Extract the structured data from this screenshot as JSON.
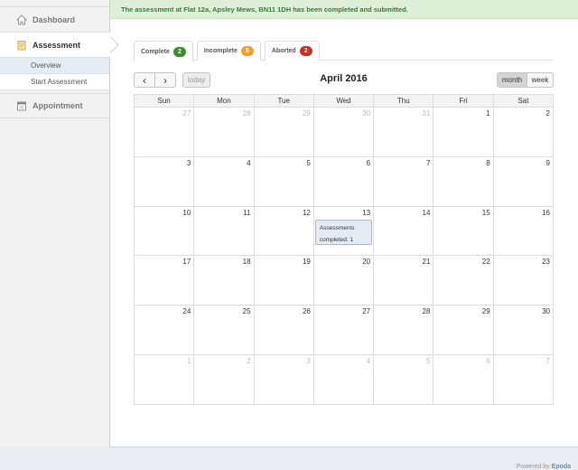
{
  "alert": {
    "text": "The assessment at Flat 12a, Apsley Mews, BN11 1DH has been completed and submitted."
  },
  "sidebar": {
    "dashboard": "Dashboard",
    "assessment": "Assessment",
    "sub": [
      "Overview",
      "Start Assessment"
    ],
    "appointment": "Appointment"
  },
  "tabs": [
    {
      "label": "Complete",
      "count": "2",
      "color": "#3c8d2f"
    },
    {
      "label": "Incomplete",
      "count": "0",
      "color": "#f0a02a"
    },
    {
      "label": "Aborted",
      "count": "2",
      "color": "#c9302c"
    }
  ],
  "toolbar": {
    "prev": "‹",
    "next": "›",
    "today": "today",
    "title": "April 2016",
    "month": "month",
    "week": "week"
  },
  "calendar": {
    "days_of_week": [
      "Sun",
      "Mon",
      "Tue",
      "Wed",
      "Thu",
      "Fri",
      "Sat"
    ],
    "weeks": [
      [
        [
          "27",
          true
        ],
        [
          "28",
          true
        ],
        [
          "29",
          true
        ],
        [
          "30",
          true
        ],
        [
          "31",
          true
        ],
        [
          "1",
          false
        ],
        [
          "2",
          false
        ]
      ],
      [
        [
          "3",
          false
        ],
        [
          "4",
          false
        ],
        [
          "5",
          false
        ],
        [
          "6",
          false
        ],
        [
          "7",
          false
        ],
        [
          "8",
          false
        ],
        [
          "9",
          false
        ]
      ],
      [
        [
          "10",
          false
        ],
        [
          "11",
          false
        ],
        [
          "12",
          false
        ],
        [
          "13",
          false
        ],
        [
          "14",
          false
        ],
        [
          "15",
          false
        ],
        [
          "16",
          false
        ]
      ],
      [
        [
          "17",
          false
        ],
        [
          "18",
          false
        ],
        [
          "19",
          false
        ],
        [
          "20",
          false
        ],
        [
          "21",
          false
        ],
        [
          "22",
          false
        ],
        [
          "23",
          false
        ]
      ],
      [
        [
          "24",
          false
        ],
        [
          "25",
          false
        ],
        [
          "26",
          false
        ],
        [
          "27",
          false
        ],
        [
          "28",
          false
        ],
        [
          "29",
          false
        ],
        [
          "30",
          false
        ]
      ],
      [
        [
          "1",
          true
        ],
        [
          "2",
          true
        ],
        [
          "3",
          true
        ],
        [
          "4",
          true
        ],
        [
          "5",
          true
        ],
        [
          "6",
          true
        ],
        [
          "7",
          true
        ]
      ]
    ],
    "event": {
      "week": 2,
      "day": 3,
      "line1": "Assessments",
      "line2": "completed: 1"
    }
  },
  "footer": {
    "prefix": "Powered by",
    "brand": "Epoda"
  }
}
